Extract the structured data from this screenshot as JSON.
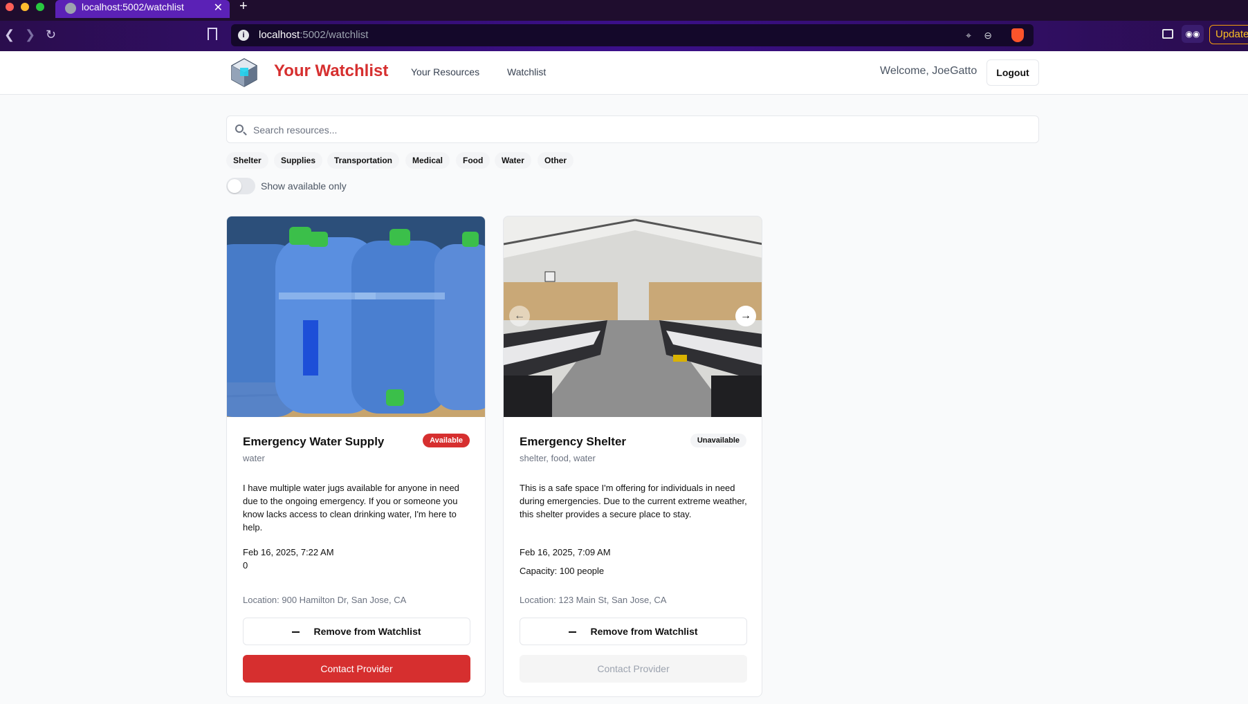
{
  "browser": {
    "tab_title": "localhost:5002/watchlist",
    "url_host": "localhost",
    "url_rest": ":5002/watchlist",
    "update_label": "Update"
  },
  "header": {
    "title": "Your Watchlist",
    "nav": [
      "Your Resources",
      "Watchlist"
    ],
    "welcome": "Welcome, JoeGatto",
    "logout": "Logout"
  },
  "search": {
    "placeholder": "Search resources..."
  },
  "filters": {
    "chips": [
      "Shelter",
      "Supplies",
      "Transportation",
      "Medical",
      "Food",
      "Water",
      "Other"
    ],
    "toggle_label": "Show available only",
    "toggle_on": false
  },
  "cards": [
    {
      "name": "Emergency Water Supply",
      "status": "Available",
      "categories": "water",
      "description": "I have multiple water jugs available for anyone in need due to the ongoing emergency. If you or someone you know lacks access to clean drinking water, I'm here to help.",
      "date": "Feb 16, 2025, 7:22 AM",
      "extra": "0",
      "location": "Location: 900 Hamilton Dr, San Jose, CA",
      "remove_label": "Remove from Watchlist",
      "contact_label": "Contact Provider"
    },
    {
      "name": "Emergency Shelter",
      "status": "Unavailable",
      "categories": "shelter, food, water",
      "description": "This is a safe space I'm offering for individuals in need during emergencies. Due to the current extreme weather, this shelter provides a secure place to stay.",
      "date": "Feb 16, 2025, 7:09 AM",
      "extra": "Capacity: 100 people",
      "location": "Location: 123 Main St, San Jose, CA",
      "remove_label": "Remove from Watchlist",
      "contact_label": "Contact Provider"
    }
  ],
  "colors": {
    "brand_red": "#d62f2f",
    "browser_purple": "#3b0f8a"
  }
}
